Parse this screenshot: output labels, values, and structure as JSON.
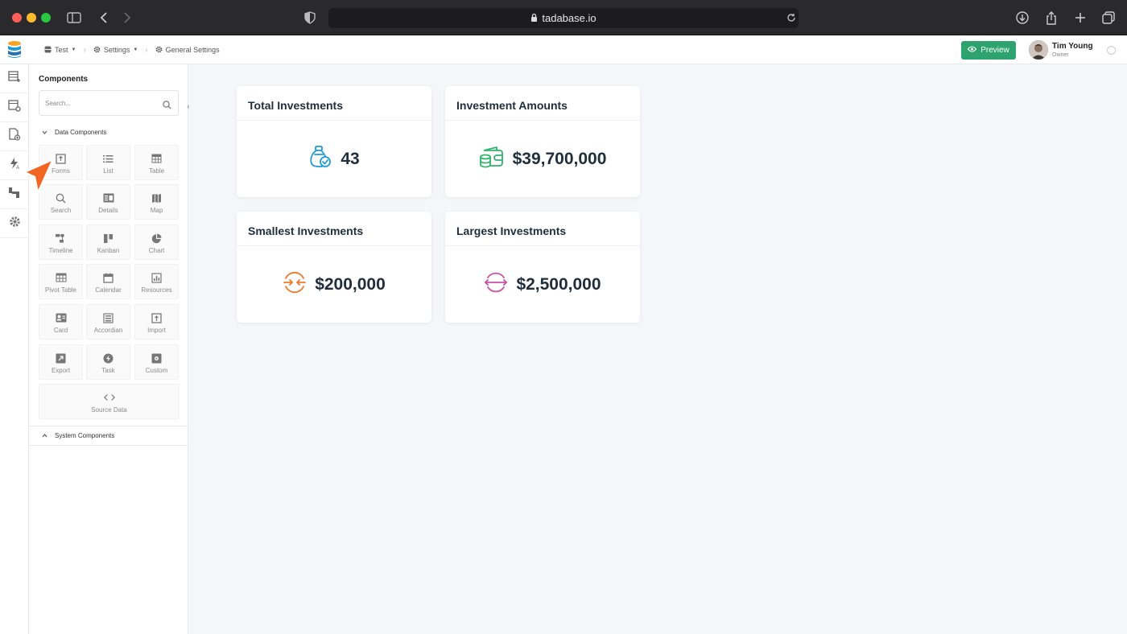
{
  "browser": {
    "url": "tadabase.io"
  },
  "breadcrumb": [
    {
      "label": "Test",
      "icon": "database-icon"
    },
    {
      "label": "Settings",
      "icon": "gear-icon"
    },
    {
      "label": "General Settings",
      "icon": "gear-icon"
    }
  ],
  "header": {
    "preview_label": "Preview",
    "user_name": "Tim Young",
    "user_role": "Owner"
  },
  "panel": {
    "title": "Components",
    "search_placeholder": "Search...",
    "data_section": "Data Components",
    "system_section": "System Components",
    "tiles": [
      {
        "label": "Forms",
        "icon": "form-icon"
      },
      {
        "label": "List",
        "icon": "list-icon"
      },
      {
        "label": "Table",
        "icon": "table-icon"
      },
      {
        "label": "Search",
        "icon": "search-icon"
      },
      {
        "label": "Details",
        "icon": "details-icon"
      },
      {
        "label": "Map",
        "icon": "map-icon"
      },
      {
        "label": "Timeline",
        "icon": "timeline-icon"
      },
      {
        "label": "Kanban",
        "icon": "kanban-icon"
      },
      {
        "label": "Chart",
        "icon": "pie-chart-icon"
      },
      {
        "label": "Pivot Table",
        "icon": "pivot-table-icon"
      },
      {
        "label": "Calendar",
        "icon": "calendar-icon"
      },
      {
        "label": "Resources",
        "icon": "resources-icon"
      },
      {
        "label": "Card",
        "icon": "card-icon"
      },
      {
        "label": "Accordian",
        "icon": "accordion-icon"
      },
      {
        "label": "Import",
        "icon": "import-icon"
      },
      {
        "label": "Export",
        "icon": "export-icon"
      },
      {
        "label": "Task",
        "icon": "bolt-icon"
      },
      {
        "label": "Custom",
        "icon": "custom-icon"
      },
      {
        "label": "Source Data",
        "icon": "code-icon"
      }
    ]
  },
  "cards": [
    {
      "title": "Total Investments",
      "value": "43",
      "icon": "money-bag-check-icon",
      "color": "#1e9bd7"
    },
    {
      "title": "Investment Amounts",
      "value": "$39,700,000",
      "icon": "wallet-coins-icon",
      "color": "#2fb36d"
    },
    {
      "title": "Smallest Investments",
      "value": "$200,000",
      "icon": "arrows-inward-icon",
      "color": "#ea7a2c"
    },
    {
      "title": "Largest Investments",
      "value": "$2,500,000",
      "icon": "arrows-outward-icon",
      "color": "#c94fa6"
    }
  ],
  "colors": {
    "accent": "#2ea36f",
    "cursor": "#f26522"
  }
}
